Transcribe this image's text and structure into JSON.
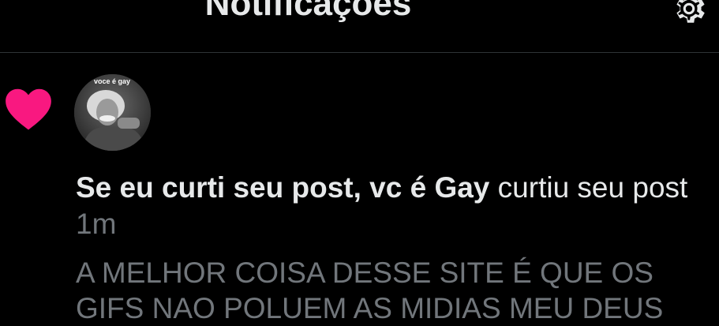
{
  "header": {
    "title": "Notificações"
  },
  "notification": {
    "icon": "heart-icon",
    "icon_color": "#f91880",
    "avatar": {
      "caption": "voce é gay"
    },
    "actor_name": "Se eu curti seu post, vc é Gay",
    "action_text": "curtiu seu post",
    "timestamp": "1m",
    "preview_lines": [
      "A MELHOR COISA DESSE SITE É QUE OS",
      "GIFS NAO POLUEM AS MIDIAS MEU DEUS"
    ]
  }
}
